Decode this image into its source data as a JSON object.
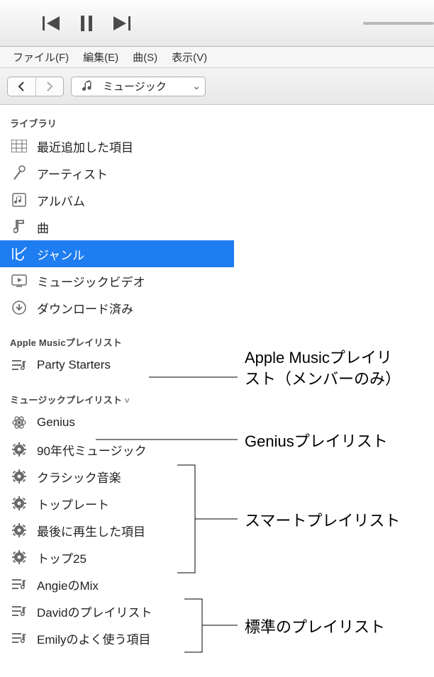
{
  "menubar": {
    "file": "ファイル(F)",
    "edit": "編集(E)",
    "song": "曲(S)",
    "view": "表示(V)"
  },
  "toolbar": {
    "section_label": "ミュージック"
  },
  "sidebar": {
    "library_header": "ライブラリ",
    "library": {
      "recently_added": "最近追加した項目",
      "artists": "アーティスト",
      "albums": "アルバム",
      "songs": "曲",
      "genres": "ジャンル",
      "music_videos": "ミュージックビデオ",
      "downloaded": "ダウンロード済み"
    },
    "apple_music_header": "Apple Musicプレイリスト",
    "apple_music": {
      "party_starters": "Party Starters"
    },
    "music_playlists_header": "ミュージックプレイリスト",
    "music_playlists": {
      "genius": "Genius",
      "smart_90s": "90年代ミュージック",
      "smart_classical": "クラシック音楽",
      "smart_top_rated": "トップレート",
      "smart_recently_played": "最後に再生した項目",
      "smart_top25": "トップ25",
      "std_angie": "AngieのMix",
      "std_david": "Davidのプレイリスト",
      "std_emily": "Emilyのよく使う項目"
    }
  },
  "callouts": {
    "apple_music": "Apple Musicプレイリ\nスト（メンバーのみ）",
    "apple_music_line1": "Apple Musicプレイリ",
    "apple_music_line2": "スト（メンバーのみ）",
    "genius": "Geniusプレイリスト",
    "smart": "スマートプレイリスト",
    "standard": "標準のプレイリスト"
  },
  "colors": {
    "selection": "#1e7df0",
    "icon_gray": "#6b6b6b"
  }
}
